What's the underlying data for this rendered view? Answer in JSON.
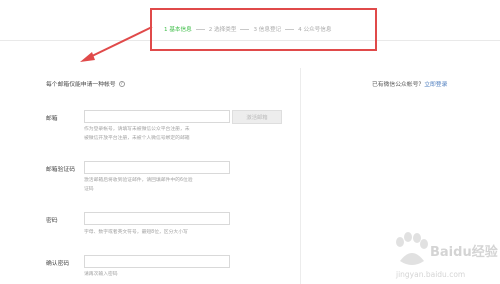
{
  "steps": [
    {
      "label": "1 基本信息",
      "active": true
    },
    {
      "label": "2 选择类型",
      "active": false
    },
    {
      "label": "3 信息登记",
      "active": false
    },
    {
      "label": "4 公众号信息",
      "active": false
    }
  ],
  "form": {
    "intro": "每个邮箱仅能申请一种帐号",
    "help_icon": "?",
    "email": {
      "label": "邮箱",
      "value": "",
      "hint_line1": "作为登录帐号，请填写未被微信公众平台注册，未",
      "hint_line2": "被微信开放平台注册，未被个人微信号绑定的邮箱",
      "activate_button": "激活邮箱"
    },
    "code": {
      "label": "邮箱验证码",
      "value": "",
      "hint_line1": "激活邮箱后将收到验证邮件，请回填邮件中的6位验",
      "hint_line2": "证码"
    },
    "password": {
      "label": "密码",
      "value": "",
      "hint": "字母、数字或者英文符号，最短8位，区分大小写"
    },
    "confirm": {
      "label": "确认密码",
      "value": "",
      "hint": "请再次输入密码"
    }
  },
  "side": {
    "question": "已有微信公众帐号？",
    "login_link": "立即登录"
  },
  "watermark": {
    "brand": "Baidu经验",
    "url": "jingyan.baidu.com"
  },
  "colors": {
    "accent_green": "#3dbd47",
    "highlight_red": "#e04a4a",
    "link_blue": "#4a7bbd"
  }
}
